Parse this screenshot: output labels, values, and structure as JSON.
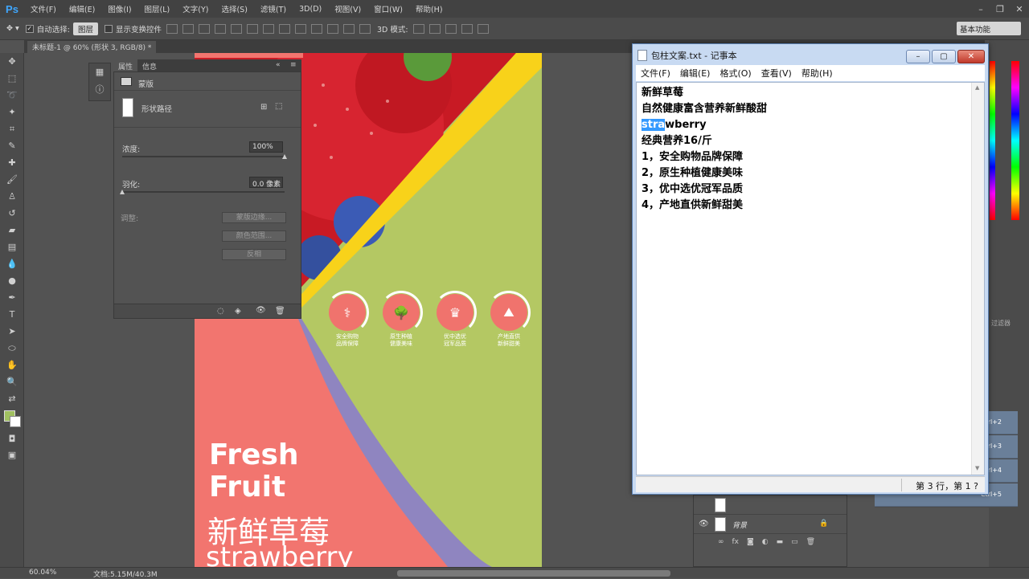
{
  "app": {
    "logo": "Ps",
    "menu": [
      "文件(F)",
      "编辑(E)",
      "图像(I)",
      "图层(L)",
      "文字(Y)",
      "选择(S)",
      "滤镜(T)",
      "3D(D)",
      "视图(V)",
      "窗口(W)",
      "帮助(H)"
    ]
  },
  "options_bar": {
    "auto_select_label": "自动选择:",
    "auto_select_checked": true,
    "auto_select_target": "图层",
    "transform_controls_label": "显示变换控件",
    "mode_3d_label": "3D 模式:",
    "workspace": "基本功能"
  },
  "document": {
    "tab_title": "未标题-1 @ 60% (形状 3, RGB/8) *"
  },
  "properties_panel": {
    "tabs": [
      "属性",
      "信息"
    ],
    "section": "蒙版",
    "shape_path_label": "形状路径",
    "density_label": "浓度:",
    "density_value": "100%",
    "density_level": 1.0,
    "feather_label": "羽化:",
    "feather_value": "0.0 像素",
    "feather_level": 0.0,
    "adjust_label": "调整:",
    "buttons": [
      "蒙版边缘...",
      "颜色范围...",
      "反相"
    ]
  },
  "poster": {
    "line1": "Fresh",
    "line2": "Fruit",
    "line3": "新鲜草莓",
    "line4": "strawberry",
    "features": [
      {
        "icon": "dna-icon",
        "label1": "安全购物",
        "label2": "品牌保障"
      },
      {
        "icon": "tree-icon",
        "label1": "原生种植",
        "label2": "健康美味"
      },
      {
        "icon": "crown-icon",
        "label1": "优中选优",
        "label2": "冠军品质"
      },
      {
        "icon": "mountain-icon",
        "label1": "产地直供",
        "label2": "新鲜甜美"
      }
    ],
    "colors": {
      "green": "#b4c863",
      "yellow": "#f8d21a",
      "pink": "#f2756f",
      "purple": "#8f85c0",
      "strawberry": "#d0202a",
      "blueberry": "#3552a8"
    }
  },
  "notepad": {
    "title": "包柱文案.txt - 记事本",
    "menu": [
      "文件(F)",
      "编辑(E)",
      "格式(O)",
      "查看(V)",
      "帮助(H)"
    ],
    "lines": [
      "新鲜草莓",
      "自然健康富含营养新鲜酸甜",
      "strawberry",
      "经典营养16/斤",
      "1，安全购物品牌保障",
      "2，原生种植健康美味",
      "3，优中选优冠军品质",
      "4，产地直供新鲜甜美"
    ],
    "selected_part": "stra",
    "unselected_part": "wberry",
    "status": "第 3 行，第 1 ?"
  },
  "layers": {
    "background_layer": "背景"
  },
  "actions": {
    "shortcuts": [
      "Ctrl+2",
      "Ctrl+3",
      "Ctrl+4",
      "Ctrl+5"
    ]
  },
  "side_note": "过滤器",
  "status_bar": {
    "zoom": "60.04%",
    "doc_info": "文档:5.15M/40.3M"
  }
}
